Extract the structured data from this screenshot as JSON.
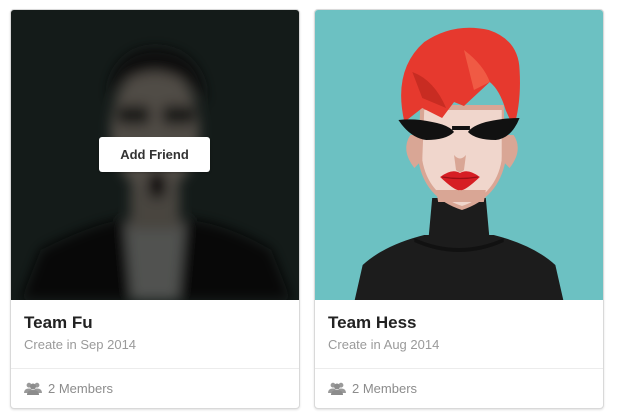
{
  "cards": [
    {
      "title": "Team Fu",
      "meta": "Create in Sep 2014",
      "members": "2 Members",
      "overlay_button": "Add Friend",
      "members_icon": "users-icon"
    },
    {
      "title": "Team Hess",
      "meta": "Create in Aug 2014",
      "members": "2 Members",
      "members_icon": "users-icon"
    }
  ],
  "colors": {
    "card_border": "#d9d9d9",
    "title": "#222222",
    "meta": "#9a9a9a",
    "teal_background": "#6cc1c2",
    "hair_red": "#e6392e",
    "dark_background": "#1f2a27"
  }
}
